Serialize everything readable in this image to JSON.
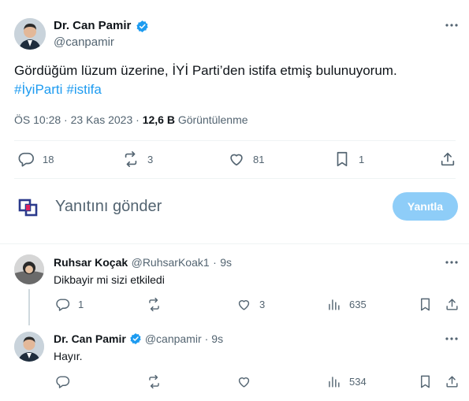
{
  "main_tweet": {
    "author_name": "Dr. Can Pamir",
    "author_handle": "@canpamir",
    "text": "Gördüğüm lüzum üzerine, İYİ Parti’den istifa etmiş bulunuyorum.",
    "hashtags": [
      "#İyiParti",
      "#istifa"
    ],
    "time": "ÖS 10:28",
    "separator": "·",
    "date": "23 Kas 2023",
    "views_count": "12,6 B",
    "views_label": "Görüntülenme",
    "stats": {
      "replies": "18",
      "reposts": "3",
      "likes": "81",
      "bookmarks": "1"
    }
  },
  "compose": {
    "placeholder": "Yanıtını gönder",
    "button_label": "Yanıtla"
  },
  "replies": [
    {
      "name": "Ruhsar Koçak",
      "handle": "@RuhsarKoak1",
      "time": "9s",
      "text": "Dikbayir mi sizi etkiledi",
      "stats": {
        "replies": "1",
        "reposts": "",
        "likes": "3",
        "views": "635"
      }
    },
    {
      "name": "Dr. Can Pamir",
      "handle": "@canpamir",
      "time": "9s",
      "text": "Hayır.",
      "stats": {
        "replies": "",
        "reposts": "",
        "likes": "",
        "views": "534"
      }
    }
  ],
  "colors": {
    "accent": "#1d9bf0",
    "muted": "#536471",
    "button_disabled": "#8ecdf8",
    "verified": "#1d9bf0"
  },
  "icons": [
    "verified-badge-icon",
    "more-icon",
    "reply-icon",
    "repost-icon",
    "like-icon",
    "bookmark-icon",
    "share-icon",
    "views-icon",
    "logo-icon"
  ]
}
